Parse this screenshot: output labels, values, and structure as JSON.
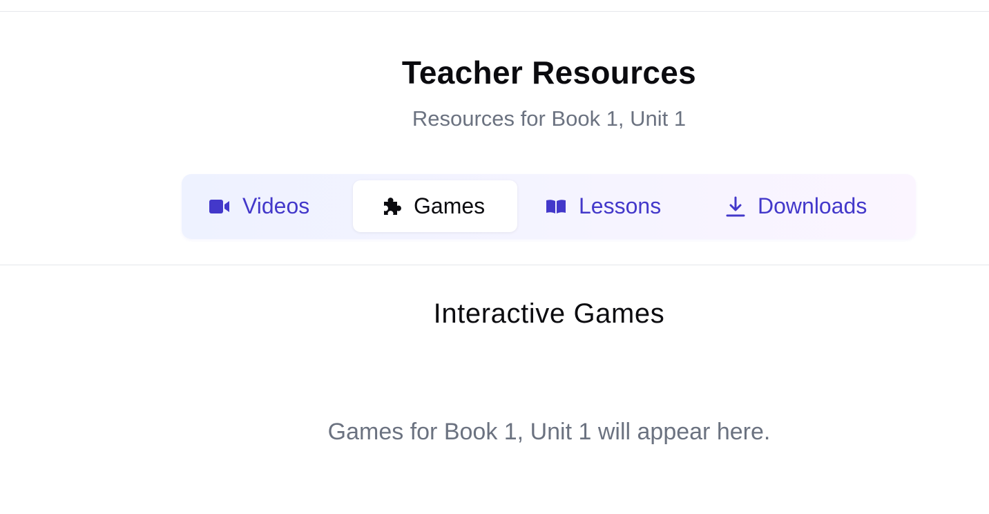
{
  "header": {
    "title": "Teacher Resources",
    "subtitle": "Resources for Book 1, Unit 1"
  },
  "tabs": [
    {
      "label": "Videos",
      "icon": "video-icon",
      "active": false
    },
    {
      "label": "Games",
      "icon": "puzzle-icon",
      "active": true
    },
    {
      "label": "Lessons",
      "icon": "book-open-icon",
      "active": false
    },
    {
      "label": "Downloads",
      "icon": "download-icon",
      "active": false
    }
  ],
  "section": {
    "title": "Interactive Games",
    "empty_message": "Games for Book 1, Unit 1 will appear here."
  },
  "colors": {
    "accent": "#4338ca",
    "text_primary": "#0b0b0f",
    "text_muted": "#6b7280",
    "divider": "#e5e7eb"
  }
}
